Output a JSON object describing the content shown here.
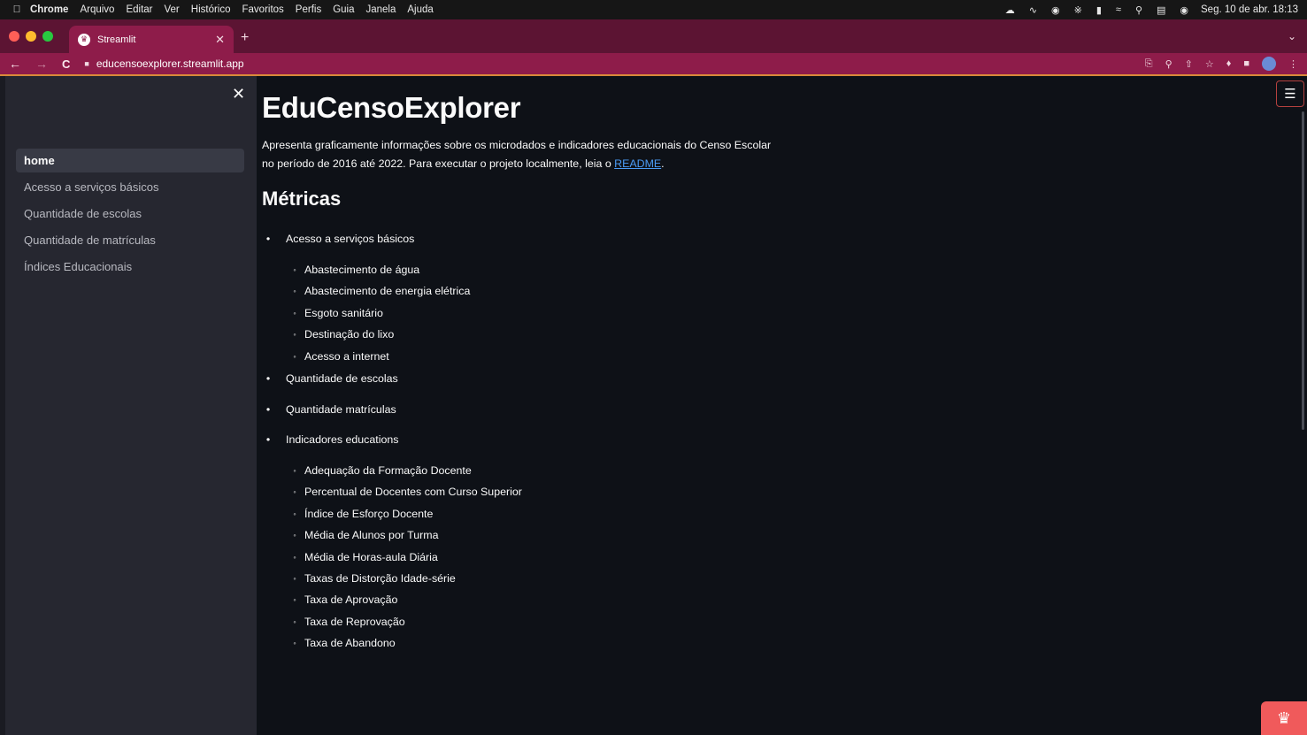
{
  "menubar": {
    "app": "Chrome",
    "items": [
      "Arquivo",
      "Editar",
      "Ver",
      "Histórico",
      "Favoritos",
      "Perfis",
      "Guia",
      "Janela",
      "Ajuda"
    ],
    "clock": "Seg. 10 de abr. 18:13"
  },
  "browser": {
    "tab_title": "Streamlit",
    "url": "educensoexplorer.streamlit.app"
  },
  "sidebar": {
    "items": [
      {
        "label": "home",
        "active": true
      },
      {
        "label": "Acesso a serviços básicos",
        "active": false
      },
      {
        "label": "Quantidade de escolas",
        "active": false
      },
      {
        "label": "Quantidade de matrículas",
        "active": false
      },
      {
        "label": "Índices Educacionais",
        "active": false
      }
    ]
  },
  "main": {
    "title": "EduCensoExplorer",
    "intro_line1": "Apresenta graficamente informações sobre os microdados e indicadores educacionais do Censo Escolar",
    "intro_line2_prefix": "no período de 2016 até 2022. Para executar o projeto localmente, leia o ",
    "readme_link": "README",
    "intro_line2_suffix": ".",
    "section_title": "Métricas",
    "metrics": [
      {
        "label": "Acesso a serviços básicos",
        "children": [
          "Abastecimento de água",
          "Abastecimento de energia elétrica",
          "Esgoto sanitário",
          "Destinação do lixo",
          "Acesso a internet"
        ]
      },
      {
        "label": "Quantidade de escolas",
        "children": []
      },
      {
        "label": "Quantidade matrículas",
        "children": []
      },
      {
        "label": "Indicadores educations",
        "children": [
          "Adequação da Formação Docente",
          "Percentual de Docentes com Curso Superior",
          "Índice de Esforço Docente",
          "Média de Alunos por Turma",
          "Média de Horas-aula Diária",
          "Taxas de Distorção Idade-série",
          "Taxa de Aprovação",
          "Taxa de Reprovação",
          "Taxa de Abandono"
        ]
      }
    ]
  },
  "colors": {
    "tab_strip": "#5c1433",
    "toolbar": "#8e1c4a",
    "sidebar_bg": "#262730",
    "main_bg": "#0e1117",
    "link": "#4b9bf5",
    "streamlit_badge": "#f05a5b"
  },
  "icons": {
    "apple": "apple-icon",
    "sidebar_close": "close-icon",
    "menu": "hamburger-menu-icon",
    "badge": "streamlit-crown-icon"
  }
}
